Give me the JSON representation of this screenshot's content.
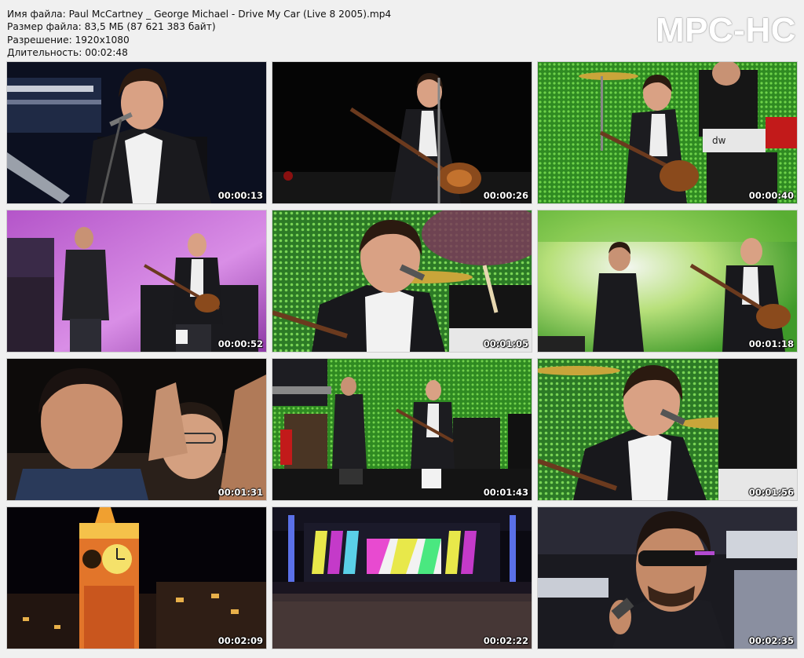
{
  "file_info": {
    "name_line": "Имя файла: Paul McCartney _ George Michael - Drive My Car (Live 8 2005).mp4",
    "size_line": "Размер файла: 83,5 МБ (87 621 383 байт)",
    "resolution_line": "Разрешение: 1920x1080",
    "duration_line": "Длительность: 00:02:48"
  },
  "logo": "MPC-HC",
  "thumbnails": [
    {
      "time": "00:00:13",
      "scene": "mccartney-closeup-keyboards"
    },
    {
      "time": "00:00:26",
      "scene": "mccartney-bass-dark-stage"
    },
    {
      "time": "00:00:40",
      "scene": "mccartney-green-screen-drummer"
    },
    {
      "time": "00:00:52",
      "scene": "duo-purple-stage"
    },
    {
      "time": "00:01:05",
      "scene": "mccartney-closeup-led-wall"
    },
    {
      "time": "00:01:18",
      "scene": "duo-green-smoke-stage"
    },
    {
      "time": "00:01:31",
      "scene": "audience-cheering"
    },
    {
      "time": "00:01:43",
      "scene": "duo-wide-green-stage"
    },
    {
      "time": "00:01:56",
      "scene": "mccartney-closeup-green-led"
    },
    {
      "time": "00:02:09",
      "scene": "big-ben-night"
    },
    {
      "time": "00:02:22",
      "scene": "hyde-park-wide-crowd"
    },
    {
      "time": "00:02:35",
      "scene": "george-michael-sunglasses"
    }
  ]
}
